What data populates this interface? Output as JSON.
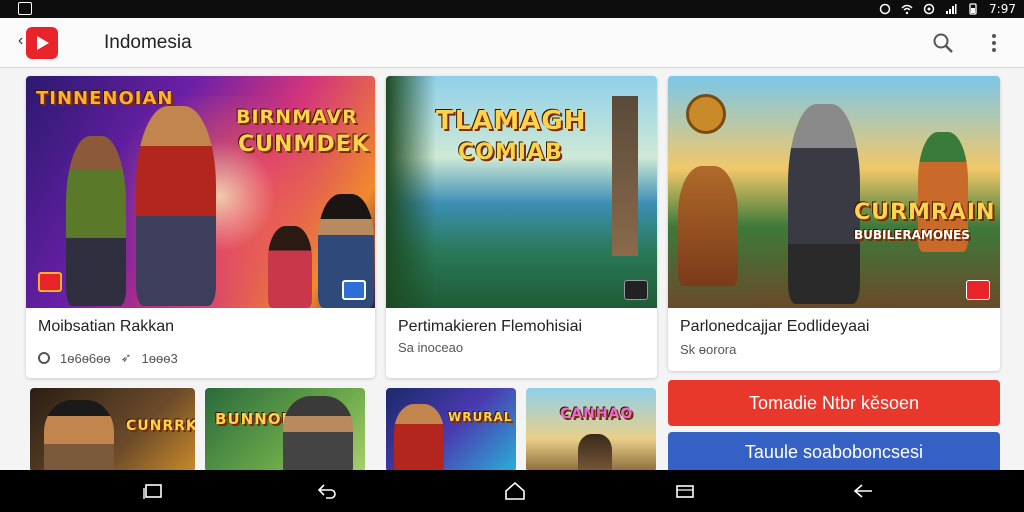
{
  "status_bar": {
    "time": "7:97",
    "icons": [
      "gallery-icon",
      "alarm-icon",
      "wifi-icon",
      "sync-icon",
      "signal-icon",
      "battery-icon"
    ]
  },
  "app_bar": {
    "title": "Indomesia",
    "logo": "play-logo-icon",
    "actions": [
      "search-icon",
      "more-vert-icon"
    ]
  },
  "featured": [
    {
      "art_title_1": "TINNENOIAN",
      "art_title_2": "BIRNMAVR",
      "art_title_3": "CUNMDEK",
      "title": "Moibsatian Rakkan",
      "downloads": "1ѳ6ѳ6ѳѳ",
      "rating": "1ѳѳѳ3"
    },
    {
      "art_title_1": "TLAMAGH",
      "art_title_2": "COMIAB",
      "title": "Pertimakieren Flemohisiai",
      "subtitle": "Sa inoceao"
    },
    {
      "art_title_1": "CURMRAIN",
      "art_title_2": "BUBILERAMONES",
      "title": "Parlonedcajjar Eodlideyaai",
      "subtitle": "Sk ɵorora"
    }
  ],
  "small_cards": [
    {
      "art_title": "CUNRRK"
    },
    {
      "art_title": "BUNNON"
    },
    {
      "art_title": "WRURAL"
    },
    {
      "art_title": "CANHAO"
    }
  ],
  "buttons": {
    "primary": "Tomadie Ntbr kěsoen",
    "secondary": "Tauule soaboboncsesi"
  },
  "nav_bar": [
    "recent-apps-icon",
    "back-icon",
    "home-icon",
    "overview-icon",
    "return-icon"
  ]
}
